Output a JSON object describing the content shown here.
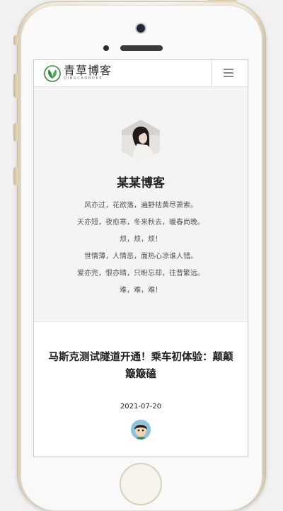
{
  "header": {
    "logo_cn": "青草博客",
    "logo_en": "QINGCAOBOKE",
    "menu_icon": "hamburger-menu-icon"
  },
  "profile": {
    "name": "某某博客",
    "lines": [
      "风亦过，花欲落，遍野枯黄尽萧索。",
      "天亦短，夜愈寒，冬来秋去，暖春尚晚。",
      "烦，烦，烦！",
      "世情薄，人情恶，面热心凉谁人错。",
      "爱亦完，恨亦晴，只盼忘却，往昔繁远。",
      "难，难，难！"
    ]
  },
  "article": {
    "title": "马斯克测试隧道开通！乘车初体验：颠颠簸簸磕",
    "date": "2021-07-20"
  },
  "colors": {
    "logo_green": "#2e8b3a",
    "page_bg": "#f4f4f4",
    "text_dark": "#222222"
  }
}
